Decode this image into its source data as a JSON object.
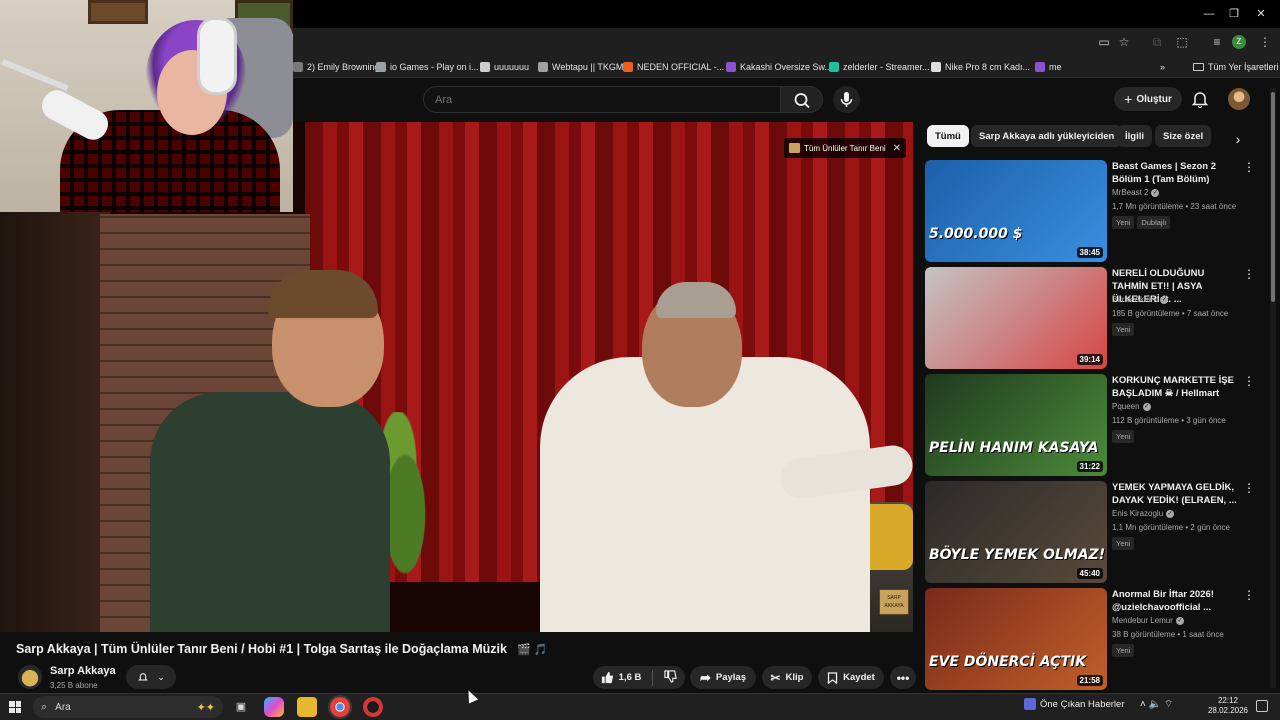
{
  "browser": {
    "bookmarks": [
      {
        "label": "2) Emily Browning...",
        "color": "#7a7a7a"
      },
      {
        "label": "io Games - Play on i...",
        "color": "#9aa0a6"
      },
      {
        "label": "uuuuuuu",
        "color": "#cccccc"
      },
      {
        "label": "Webtapu || TKGM",
        "color": "#a0a0a0"
      },
      {
        "label": "NEDEN OFFICIAL -...",
        "color": "#e8601c"
      },
      {
        "label": "Kakashi Oversize Sw...",
        "color": "#8a52d1"
      },
      {
        "label": "zelderler - Streamer...",
        "color": "#1ec0a0"
      },
      {
        "label": "Nike Pro 8 cm Kadı...",
        "color": "#dddddd"
      },
      {
        "label": "me",
        "color": "#8a52d1"
      }
    ],
    "all_bookmarks": "Tüm Yer İşaretleri",
    "more_bookmarks": "»",
    "profile_initial": "Z"
  },
  "header": {
    "search_placeholder": "Ara",
    "create_label": "Oluştur"
  },
  "player": {
    "infocard_label": "Tüm Ünlüler Tanır Beni",
    "logo_text": "SARP AKKAYA"
  },
  "video": {
    "title": "Sarp Akkaya | Tüm Ünlüler Tanır Beni / Hobi #1 | Tolga Sarıtaş ile Doğaçlama Müzik",
    "title_emoji": "🎬 🎵",
    "channel_name": "Sarp Akkaya",
    "subscribers": "3,25 B abone",
    "likes": "1,6 B",
    "share_label": "Paylaş",
    "clip_label": "Klip",
    "save_label": "Kaydet"
  },
  "sidebar": {
    "chips": [
      "Tümü",
      "Sarp Akkaya adlı yükleyiciden",
      "İlgili",
      "Size özel"
    ],
    "videos": [
      {
        "title": "Beast Games | Sezon 2 Bölüm 1 (Tam Bölüm)",
        "channel": "MrBeast 2",
        "meta": "1,7 Mn görüntüleme • 23 saat önce",
        "badges": [
          "Yeni",
          "Dublajlı"
        ],
        "duration": "38:45",
        "overlay": "5.000.000 $",
        "thumb_colors": [
          "#1b5fa8",
          "#3a8fe0"
        ]
      },
      {
        "title": "NERELİ OLDUĞUNU TAHMİN ET!! | ASYA ÜLKELERİ ft. ...",
        "channel": "Burak Aktürk",
        "meta": "185 B görüntüleme • 7 saat önce",
        "badges": [
          "Yeni"
        ],
        "duration": "39:14",
        "overlay": "",
        "thumb_colors": [
          "#c4c4c4",
          "#d64545"
        ]
      },
      {
        "title": "KORKUNÇ MARKETTE İŞE BAŞLADIM ☠ / Hellmart",
        "channel": "Pqueen",
        "meta": "112 B görüntüleme • 3 gün önce",
        "badges": [
          "Yeni"
        ],
        "duration": "31:22",
        "overlay": "PELİN HANIM KASAYA",
        "thumb_colors": [
          "#1e3a1e",
          "#4d8a3a"
        ]
      },
      {
        "title": "YEMEK YAPMAYA GELDİK, DAYAK YEDİK! (ELRAEN, ...",
        "channel": "Enis Kirazoglu",
        "meta": "1,1 Mn görüntüleme • 2 gün önce",
        "badges": [
          "Yeni"
        ],
        "duration": "45:40",
        "overlay": "BÖYLE YEMEK OLMAZ!",
        "thumb_colors": [
          "#2a2a2a",
          "#5a4a3a"
        ]
      },
      {
        "title": "Anormal Bir İftar 2026! @uzielchavoofficial ...",
        "channel": "Mendebur Lemur",
        "meta": "38 B görüntüleme • 1 saat önce",
        "badges": [
          "Yeni"
        ],
        "duration": "21:58",
        "overlay": "EVE DÖNERCİ AÇTIK",
        "thumb_colors": [
          "#7a2a1a",
          "#c0602a"
        ]
      }
    ]
  },
  "taskbar": {
    "search_placeholder": "Ara",
    "news_label": "Öne Çıkan Haberler",
    "time": "22:12",
    "date": "28.02.2026"
  }
}
